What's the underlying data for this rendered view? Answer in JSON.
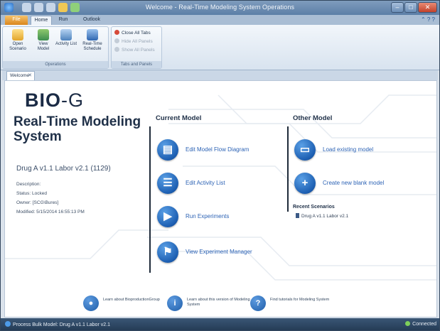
{
  "window": {
    "title": "Welcome - Real-Time Modeling System Operations",
    "controls": {
      "minimize": "–",
      "maximize": "□",
      "close": "✕"
    }
  },
  "ribbon": {
    "tabs": [
      "File",
      "Home",
      "Run",
      "Outlook"
    ],
    "help_icons": "⌃ ? ?",
    "groups": [
      {
        "label": "Operations",
        "buttons": [
          {
            "label": "Open Scenario",
            "icon": "folder-icon"
          },
          {
            "label": "View Model",
            "icon": "model-icon"
          },
          {
            "label": "Activity List",
            "icon": "list-icon"
          },
          {
            "label": "Real-Time Schedule",
            "icon": "schedule-icon"
          }
        ]
      },
      {
        "label": "Tabs and Panels",
        "items": [
          {
            "label": "Close All Tabs",
            "enabled": true
          },
          {
            "label": "Hide All Panels",
            "enabled": false
          },
          {
            "label": "Show All Panels",
            "enabled": false
          }
        ]
      }
    ]
  },
  "doc_tab": {
    "label": "Welcome",
    "close": "✕"
  },
  "welcome": {
    "logo": {
      "part1": "BIO",
      "part2": "-G"
    },
    "heading": "Real-Time Modeling System",
    "scenario_name": "Drug A v1.1 Labor v2.1 (1129)",
    "info": [
      "Description:",
      "Status: Locked",
      "Owner: [SCG\\Bures]",
      "Modified: 5/15/2014 16:55:13 PM"
    ],
    "current_model": {
      "title": "Current Model",
      "actions": [
        {
          "label": "Edit Model Flow Diagram",
          "icon": "flow-diagram-icon",
          "glyph": "▤"
        },
        {
          "label": "Edit Activity List",
          "icon": "activity-list-icon",
          "glyph": "☰"
        },
        {
          "label": "Run Experiments",
          "icon": "play-icon",
          "glyph": "▶"
        },
        {
          "label": "View Experiment Manager",
          "icon": "checkered-flag-icon",
          "glyph": "⚑"
        }
      ]
    },
    "other_model": {
      "title": "Other Model",
      "actions": [
        {
          "label": "Load existing model",
          "icon": "load-model-icon",
          "glyph": "▭"
        },
        {
          "label": "Create new blank model",
          "icon": "plus-icon",
          "glyph": "+"
        }
      ],
      "recent_title": "Recent Scenarios",
      "recent_items": [
        "Drug A v1.1 Labor v2.1"
      ]
    },
    "footer_links": [
      {
        "text": "Learn about BioproductionGroup",
        "icon": "group-icon",
        "glyph": "●"
      },
      {
        "text": "Learn about this version of Modeling System",
        "icon": "info-icon",
        "glyph": "i"
      },
      {
        "text": "Find tutorials for Modeling System",
        "icon": "help-icon",
        "glyph": "?"
      }
    ]
  },
  "status_bar": {
    "left": "Process Bulk Model: Drug A v1.1 Labor v2.1",
    "right": "Connected"
  },
  "colors": {
    "accent_blue": "#1d5fb2",
    "link_blue": "#2d63b5",
    "file_tab": "#d9861d",
    "status_bar": "#2c4563"
  }
}
